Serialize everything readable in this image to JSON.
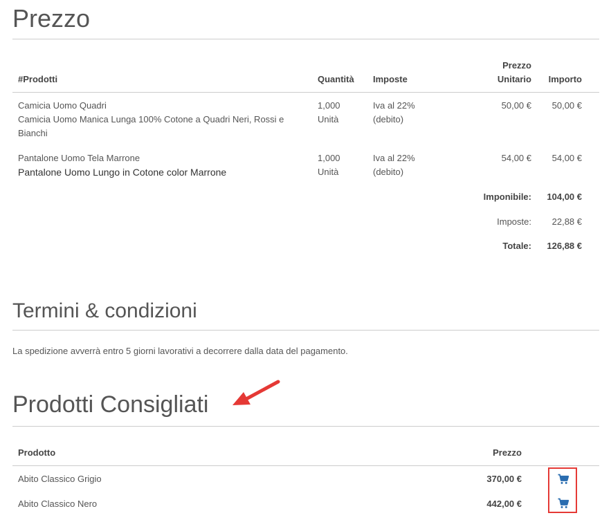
{
  "price_section": {
    "title": "Prezzo",
    "headers": {
      "product": "#Prodotti",
      "quantity": "Quantità",
      "taxes": "Imposte",
      "unit_price_line1": "Prezzo",
      "unit_price_line2": "Unitario",
      "amount": "Importo"
    },
    "items": [
      {
        "name": "Camicia Uomo Quadri",
        "description_line1": "Camicia Uomo Manica Lunga 100% Cotone a Quadri Neri, Rossi e",
        "description_line2": "Bianchi",
        "quantity": "1,000",
        "unit": "Unità",
        "tax_line1": "Iva al 22%",
        "tax_line2": "(debito)",
        "unit_price": "50,00 €",
        "amount": "50,00 €"
      },
      {
        "name": "Pantalone Uomo Tela Marrone",
        "description_line1": "Pantalone Uomo Lungo in Cotone color Marrone",
        "quantity": "1,000",
        "unit": "Unità",
        "tax_line1": "Iva al 22%",
        "tax_line2": "(debito)",
        "unit_price": "54,00 €",
        "amount": "54,00 €"
      }
    ],
    "totals": {
      "taxable_label": "Imponibile:",
      "taxable_value": "104,00 €",
      "taxes_label": "Imposte:",
      "taxes_value": "22,88 €",
      "total_label": "Totale:",
      "total_value": "126,88 €"
    }
  },
  "terms_section": {
    "title": "Termini & condizioni",
    "text": "La spedizione avverrà entro 5 giorni lavorativi a decorrere dalla data del pagamento."
  },
  "recommended_section": {
    "title": "Prodotti Consigliati",
    "headers": {
      "product": "Prodotto",
      "price": "Prezzo"
    },
    "items": [
      {
        "name": "Abito Classico Grigio",
        "price": "370,00 €",
        "cart_icon": "cart-icon"
      },
      {
        "name": "Abito Classico Nero",
        "price": "442,00 €",
        "cart_icon": "cart-icon"
      }
    ]
  },
  "colors": {
    "accent_cart": "#2a6db0",
    "highlight_annotation": "#e53935",
    "text": "#555555",
    "rule": "#cccccc"
  }
}
